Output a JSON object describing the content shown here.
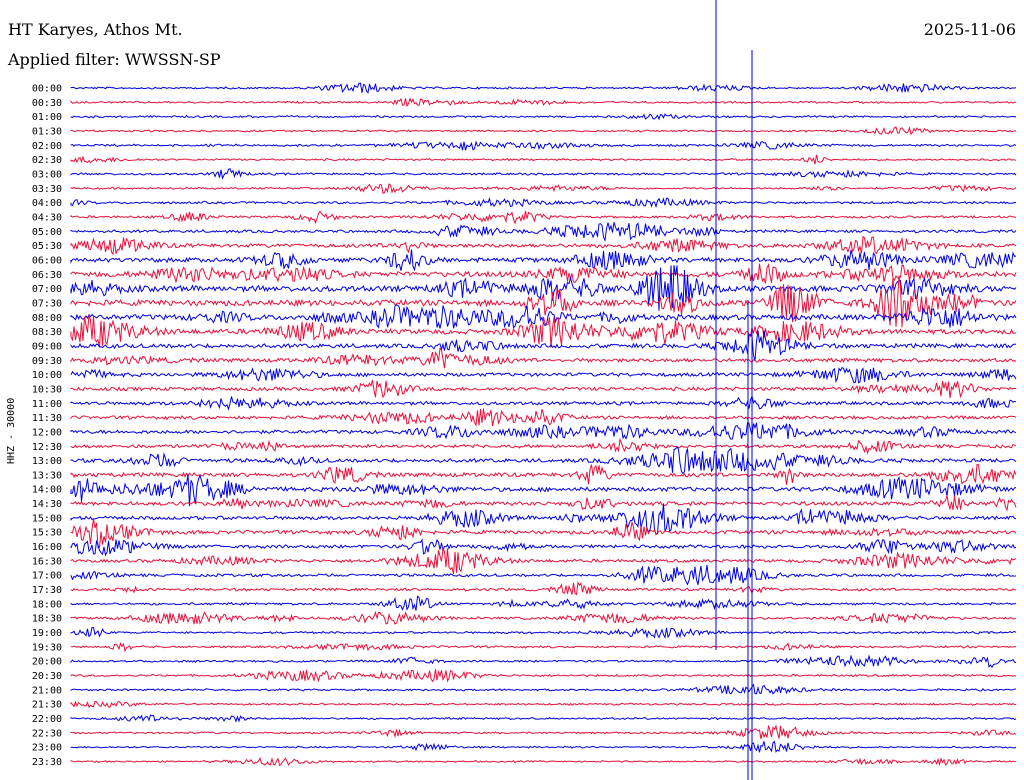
{
  "header": {
    "station": "HT Karyes, Athos Mt.",
    "filter": "Applied filter: WWSSN-SP",
    "date": "2025-11-06"
  },
  "chart_data": {
    "type": "line",
    "title": "HT Karyes, Athos Mt.",
    "subtitle": "Applied filter: WWSSN-SP",
    "ylabel": "HHZ - 30000",
    "row_labels": [
      "00:00",
      "00:30",
      "01:00",
      "01:30",
      "02:00",
      "02:30",
      "03:00",
      "03:30",
      "04:00",
      "04:30",
      "05:00",
      "05:30",
      "06:00",
      "06:30",
      "07:00",
      "07:30",
      "08:00",
      "08:30",
      "09:00",
      "09:30",
      "10:00",
      "10:30",
      "11:00",
      "11:30",
      "12:00",
      "12:30",
      "13:00",
      "13:30",
      "14:00",
      "14:30",
      "15:00",
      "15:30",
      "16:00",
      "16:30",
      "17:00",
      "17:30",
      "18:00",
      "18:30",
      "19:00",
      "19:30",
      "20:00",
      "20:30",
      "21:00",
      "21:30",
      "22:00",
      "22:30",
      "23:00",
      "23:30"
    ],
    "trace_colors": [
      "#0000e6",
      "#e8103c"
    ],
    "relative_amplitude": [
      0.45,
      0.4,
      0.45,
      0.4,
      0.5,
      0.45,
      0.5,
      0.45,
      0.6,
      0.6,
      0.8,
      1.2,
      1.5,
      1.8,
      2.0,
      2.0,
      1.8,
      1.6,
      1.4,
      1.2,
      1.1,
      1.1,
      1.0,
      1.0,
      1.1,
      1.0,
      1.2,
      1.3,
      1.4,
      1.2,
      1.1,
      1.1,
      1.0,
      0.9,
      0.8,
      0.7,
      0.6,
      0.6,
      0.5,
      0.5,
      0.5,
      0.5,
      0.45,
      0.45,
      0.45,
      0.4,
      0.35,
      0.3
    ]
  }
}
